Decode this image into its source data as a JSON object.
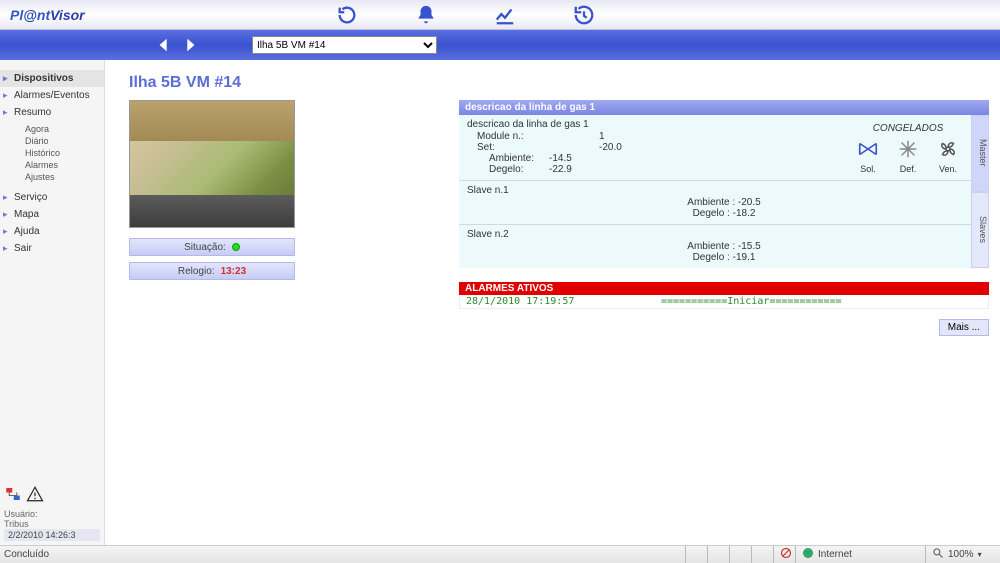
{
  "app": {
    "name": "Pl@ntVisor"
  },
  "top_tools": {
    "refresh": "refresh",
    "alarm": "alarm-bell",
    "chart": "trend",
    "history": "history"
  },
  "nav": {
    "prev": "◀",
    "next": "▶",
    "device_selected": "Ilha 5B VM #14"
  },
  "sidebar": {
    "items": [
      {
        "label": "Dispositivos",
        "active": true
      },
      {
        "label": "Alarmes/Eventos"
      },
      {
        "label": "Resumo",
        "sub": [
          "Agora",
          "Diário",
          "Histórico",
          "Alarmes",
          "Ajustes"
        ]
      },
      {
        "label": "Serviço"
      },
      {
        "label": "Mapa"
      },
      {
        "label": "Ajuda"
      },
      {
        "label": "Sair"
      }
    ],
    "user_label": "Usuário:",
    "user_name": "Tribus",
    "timestamp": "2/2/2010 14:26:3"
  },
  "page": {
    "title": "Ilha 5B VM #14",
    "status_label": "Situação:",
    "clock_label": "Relogio:",
    "clock_value": "13:23"
  },
  "gas_line": {
    "header": "descricao da linha de gas 1",
    "desc_label": "descricao da linha de gas 1",
    "module_label": "Module n.:",
    "module_value": "1",
    "set_label": "Set:",
    "set_value": "-20.0",
    "amb_label": "Ambiente:",
    "amb_value": "-14.5",
    "deg_label": "Degelo:",
    "deg_value": "-22.9",
    "cong_label": "CONGELADOS",
    "icons": {
      "sol": "Sol.",
      "def": "Def.",
      "ven": "Ven."
    },
    "slaves": [
      {
        "name": "Slave n.1",
        "amb_label": "Ambiente :",
        "amb": "-20.5",
        "deg_label": "Degelo :",
        "deg": "-18.2"
      },
      {
        "name": "Slave n.2",
        "amb_label": "Ambiente :",
        "amb": "-15.5",
        "deg_label": "Degelo :",
        "deg": "-19.1"
      }
    ],
    "side_tabs": {
      "master": "Master",
      "slaves": "Slaves"
    }
  },
  "alarms": {
    "header": "ALARMES ATIVOS",
    "rows": [
      {
        "ts": "28/1/2010 17:19:57",
        "msg": "===========Iniciar============"
      }
    ],
    "more": "Mais ..."
  },
  "statusbar": {
    "left": "Concluído",
    "zone": "Internet",
    "zoom": "100%"
  }
}
